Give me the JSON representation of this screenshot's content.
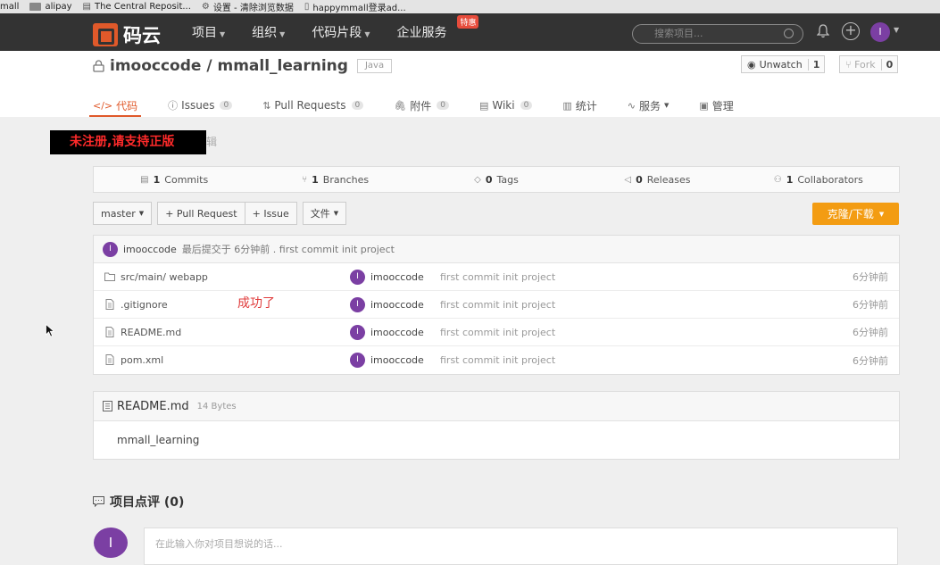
{
  "bookmarks": [
    {
      "label": "mall",
      "icon": "none"
    },
    {
      "label": "alipay",
      "icon": "folder-icon"
    },
    {
      "label": "The Central Reposit...",
      "icon": "book-icon"
    },
    {
      "label": "设置 - 清除浏览数据",
      "icon": "gear-icon"
    },
    {
      "label": "happymmall登录ad...",
      "icon": "page-icon"
    }
  ],
  "topnav": {
    "brand": "码云",
    "items": [
      {
        "label": "项目",
        "caret": true
      },
      {
        "label": "组织",
        "caret": true
      },
      {
        "label": "代码片段",
        "caret": true
      },
      {
        "label": "企业服务",
        "caret": false,
        "badge": "特惠"
      }
    ],
    "search_placeholder": "搜索项目...",
    "user_initial": "I"
  },
  "repo": {
    "title": "imooccode / mmall_learning",
    "language": "Java",
    "watch_label": "Unwatch",
    "watch_count": "1",
    "fork_label": "Fork",
    "fork_count": "0"
  },
  "tabs": [
    {
      "label": "代码",
      "icon": "</>",
      "count": null,
      "active": true
    },
    {
      "label": "Issues",
      "icon": "ⓘ",
      "count": "0",
      "active": false
    },
    {
      "label": "Pull Requests",
      "icon": "⇅",
      "count": "0",
      "active": false
    },
    {
      "label": "附件",
      "icon": "🖇",
      "count": "0",
      "active": false
    },
    {
      "label": "Wiki",
      "icon": "▤",
      "count": "0",
      "active": false
    },
    {
      "label": "统计",
      "icon": "▥",
      "count": null,
      "active": false
    },
    {
      "label": "服务",
      "icon": "∿",
      "count": null,
      "caret": true,
      "active": false
    },
    {
      "label": "管理",
      "icon": "▣",
      "count": null,
      "active": false
    }
  ],
  "watermark": {
    "text": "未注册,请支持正版",
    "tail": "辑"
  },
  "stats": [
    {
      "count": "1",
      "label": "Commits",
      "icon": "▤"
    },
    {
      "count": "1",
      "label": "Branches",
      "icon": "⑂"
    },
    {
      "count": "0",
      "label": "Tags",
      "icon": "◇"
    },
    {
      "count": "0",
      "label": "Releases",
      "icon": "◁"
    },
    {
      "count": "1",
      "label": "Collaborators",
      "icon": "⚇"
    }
  ],
  "toolbar": {
    "branch": "master",
    "pull_request": "+ Pull Request",
    "issue": "+ Issue",
    "files": "文件",
    "clone": "克隆/下载"
  },
  "latest_commit": {
    "author": "imooccode",
    "text": "最后提交于 6分钟前 . first commit init project"
  },
  "files": [
    {
      "name": "src/main/ webapp",
      "type": "folder",
      "author": "imooccode",
      "message": "first commit init project",
      "time": "6分钟前"
    },
    {
      "name": ".gitignore",
      "type": "file",
      "author": "imooccode",
      "message": "first commit init project",
      "time": "6分钟前"
    },
    {
      "name": "README.md",
      "type": "file",
      "author": "imooccode",
      "message": "first commit init project",
      "time": "6分钟前"
    },
    {
      "name": "pom.xml",
      "type": "file",
      "author": "imooccode",
      "message": "first commit init project",
      "time": "6分钟前"
    }
  ],
  "overlay_note": "成功了",
  "readme": {
    "filename": "README.md",
    "size": "14 Bytes",
    "content": "mmall_learning"
  },
  "comments": {
    "title": "项目点评 (0)",
    "placeholder": "在此输入你对项目想说的话...",
    "avatar_initial": "I"
  },
  "colors": {
    "nav_bg": "#333333",
    "brand_accent": "#e0592a",
    "clone_button": "#f39c12",
    "avatar": "#7b3fa3",
    "watermark_text": "#ff2a2a"
  }
}
